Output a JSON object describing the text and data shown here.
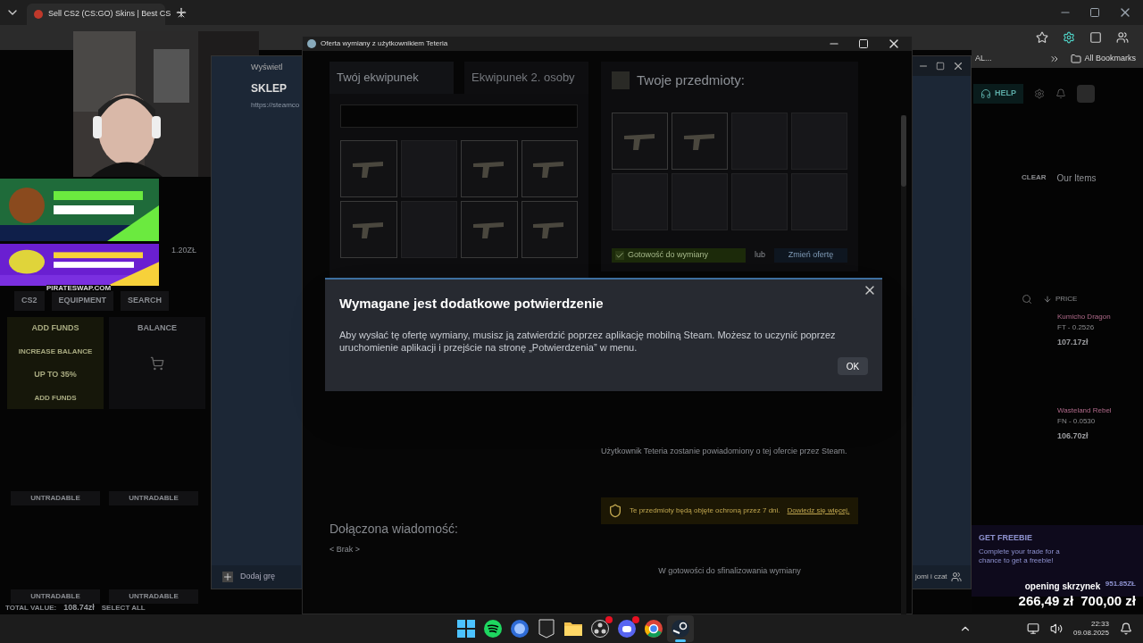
{
  "browser": {
    "tab_title": "Sell CS2 (CS:GO) Skins | Best CS",
    "bookmark": "AL...",
    "all_bookmarks": "All Bookmarks"
  },
  "banner_caption": "PIRATESWAP.COM",
  "site_left": {
    "nav": [
      "CS2",
      "EQUIPMENT",
      "SEARCH"
    ],
    "add_funds_title": "ADD FUNDS",
    "promo": "INCREASE BALANCE",
    "promo_2": "UP TO 35%",
    "add_funds_button": "ADD FUNDS",
    "balance_title": "BALANCE",
    "item_price": "1.20ZŁ",
    "statuses": [
      "UNTRADABLE",
      "UNTRADABLE",
      "UNTRADABLE",
      "UNTRADABLE"
    ],
    "total_label": "TOTAL VALUE:",
    "total": "108.74zł",
    "select_all": "SELECT ALL"
  },
  "site_right": {
    "help": "HELP",
    "clear": "CLEAR",
    "our_items": "Our Items",
    "sort": "PRICE",
    "items": [
      {
        "name": "Kumicho Dragon",
        "wear": "FT - 0.2526",
        "price": "107.17zł"
      },
      {
        "name": "Wasteland Rebel",
        "wear": "FN - 0.0530",
        "price": "106.70zł"
      }
    ],
    "promo_title": "GET FREEBIE",
    "promo_text": "Complete your trade for a chance to get a freebie!",
    "promo_price": "951.85ZŁ"
  },
  "steam_client": {
    "nav_label": "Wyświetl",
    "title": "SKLEP",
    "url": "https://steamco",
    "add_game": "Dodaj grę",
    "friends": "jomi i czat"
  },
  "trade_window": {
    "title": "Oferta wymiany z użytkownikiem Teteria",
    "tabs": [
      {
        "label": "Twój ekwipunek",
        "selected": true
      },
      {
        "label": "Ekwipunek 2. osoby",
        "selected": false
      }
    ],
    "inventory_slots": [
      {
        "filled": true
      },
      {
        "filled": false
      },
      {
        "filled": true
      },
      {
        "filled": true
      },
      {
        "filled": true
      },
      {
        "filled": false
      },
      {
        "filled": true
      },
      {
        "filled": true
      }
    ],
    "offer_title": "Twoje przedmioty:",
    "offer_slots": [
      {
        "filled": true
      },
      {
        "filled": true
      },
      {
        "filled": false
      },
      {
        "filled": false
      },
      {
        "filled": false
      },
      {
        "filled": false
      },
      {
        "filled": false
      },
      {
        "filled": false
      }
    ],
    "ready": {
      "label": "Gotowość do wymiany",
      "checked": true
    },
    "or": "lub",
    "change_button": "Zmień ofertę",
    "notify": "Użytkownik Teteria zostanie powiadomiony o tej ofercie przez Steam.",
    "message_title": "Dołączona wiadomość:",
    "message": "< Brak >",
    "protection": {
      "text": "Te przedmioty będą objęte ochroną przez 7 dni.",
      "link": "Dowiedz się więcej."
    },
    "status": "W gotowości do sfinalizowania wymiany"
  },
  "dialog": {
    "title": "Wymagane jest dodatkowe potwierdzenie",
    "body": "Aby wysłać tę ofertę wymiany, musisz ją zatwierdzić poprzez aplikację mobilną Steam. Możesz to uczynić poprzez uruchomienie aplikacji i przejście na stronę „Potwierdzenia” w menu.",
    "ok": "OK"
  },
  "stream_overlay": {
    "label": "opening skrzynek",
    "amounts": [
      "266,49 zł",
      "700,00 zł"
    ]
  },
  "taskbar": {
    "apps": [
      {
        "kind": "start",
        "badge": false,
        "selected": false
      },
      {
        "kind": "music",
        "badge": false,
        "selected": false
      },
      {
        "kind": "orb",
        "badge": false,
        "selected": false
      },
      {
        "kind": "epic",
        "badge": false,
        "selected": false
      },
      {
        "kind": "folder",
        "badge": false,
        "selected": false
      },
      {
        "kind": "record",
        "badge": true,
        "selected": false
      },
      {
        "kind": "chat",
        "badge": true,
        "selected": false
      },
      {
        "kind": "browser",
        "badge": false,
        "selected": false
      },
      {
        "kind": "steam",
        "badge": false,
        "selected": true
      }
    ],
    "time": "22:33",
    "date": "09.08.2025"
  }
}
